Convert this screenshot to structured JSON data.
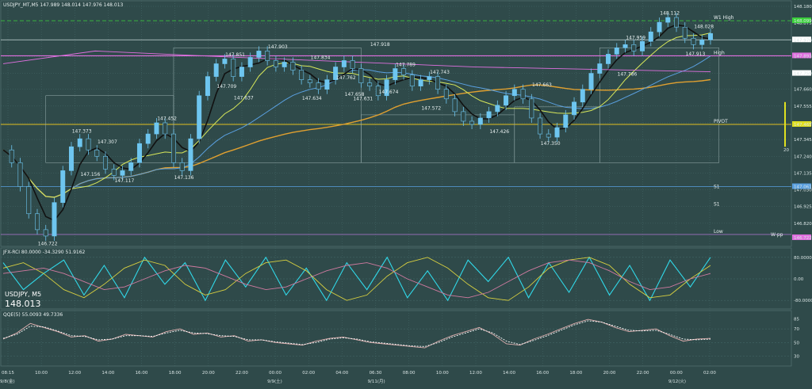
{
  "header": {
    "symbol_line": "USDJPY_MT,M5  147.989 148.014 147.976 148.013",
    "jfx_line": "JFX-RCI 80.0000 -34.3290 51.9162",
    "qqe_line": "QQE(5) 55.0093 49.7336",
    "big_symbol": "USDJPY, M5",
    "big_price": "148.013"
  },
  "colors": {
    "background": "#2f4a4a",
    "grid": "#466a6a",
    "candle": "#6ec6f0",
    "ma_fast": "#d8e85a",
    "ma_black": "#111111",
    "ma_blue": "#5aa0e0",
    "ma_orange": "#e0a030",
    "pink": "#e070e0",
    "green_dash": "#3cd43c",
    "rci_cyan": "#30d8e8",
    "rci_yellow": "#d8d040",
    "rci_pink": "#d07aa0",
    "qqe_line": "#e0b0b0"
  },
  "chart_data": [
    {
      "type": "line",
      "name": "price",
      "ylim": [
        146.7,
        148.18
      ],
      "y_ticks": [
        "148.180",
        "148.075",
        "147.970",
        "147.865",
        "147.760",
        "147.660",
        "147.555",
        "147.450",
        "147.345",
        "147.240",
        "147.135",
        "147.030",
        "146.925",
        "146.820"
      ],
      "x_ticks": [
        "08:15",
        "10:00",
        "12:00",
        "14:00",
        "16:00",
        "18:00",
        "20:00",
        "22:00",
        "00:00",
        "02:00",
        "04:00",
        "06:30",
        "08:00",
        "10:00",
        "12:00",
        "14:00",
        "16:00",
        "18:00",
        "20:00",
        "22:00",
        "00:00",
        "02:00"
      ],
      "date_labels": [
        {
          "text": "9/8(金)",
          "at_tick": 0
        },
        {
          "text": "9/9(土)",
          "at_tick": 8
        },
        {
          "text": "9/11(月)",
          "at_tick": 11
        },
        {
          "text": "9/12(火)",
          "at_tick": 20
        }
      ],
      "price_points": [
        [
          0,
          147.28
        ],
        [
          1,
          147.2
        ],
        [
          2,
          147.05
        ],
        [
          3,
          146.88
        ],
        [
          4,
          146.78
        ],
        [
          5,
          146.74
        ],
        [
          6,
          146.95
        ],
        [
          7,
          147.15
        ],
        [
          8,
          147.3
        ],
        [
          9,
          147.35
        ],
        [
          10,
          147.28
        ],
        [
          11,
          147.24
        ],
        [
          12,
          147.16
        ],
        [
          13,
          147.12
        ],
        [
          14,
          147.15
        ],
        [
          15,
          147.2
        ],
        [
          16,
          147.32
        ],
        [
          17,
          147.38
        ],
        [
          18,
          147.45
        ],
        [
          19,
          147.38
        ],
        [
          20,
          147.2
        ],
        [
          21,
          147.15
        ],
        [
          22,
          147.35
        ],
        [
          23,
          147.62
        ],
        [
          24,
          147.74
        ],
        [
          25,
          147.82
        ],
        [
          26,
          147.85
        ],
        [
          27,
          147.74
        ],
        [
          28,
          147.8
        ],
        [
          29,
          147.86
        ],
        [
          30,
          147.9
        ],
        [
          31,
          147.84
        ],
        [
          32,
          147.8
        ],
        [
          33,
          147.83
        ],
        [
          34,
          147.78
        ],
        [
          35,
          147.72
        ],
        [
          36,
          147.7
        ],
        [
          37,
          147.66
        ],
        [
          38,
          147.72
        ],
        [
          39,
          147.8
        ],
        [
          40,
          147.84
        ],
        [
          41,
          147.79
        ],
        [
          42,
          147.7
        ],
        [
          43,
          147.68
        ],
        [
          44,
          147.62
        ],
        [
          45,
          147.72
        ],
        [
          46,
          147.79
        ],
        [
          47,
          147.75
        ],
        [
          48,
          147.68
        ],
        [
          49,
          147.72
        ],
        [
          50,
          147.74
        ],
        [
          51,
          147.66
        ],
        [
          52,
          147.6
        ],
        [
          53,
          147.52
        ],
        [
          54,
          147.46
        ],
        [
          55,
          147.44
        ],
        [
          56,
          147.48
        ],
        [
          57,
          147.52
        ],
        [
          58,
          147.56
        ],
        [
          59,
          147.62
        ],
        [
          60,
          147.66
        ],
        [
          61,
          147.6
        ],
        [
          62,
          147.48
        ],
        [
          63,
          147.38
        ],
        [
          64,
          147.36
        ],
        [
          65,
          147.42
        ],
        [
          66,
          147.5
        ],
        [
          67,
          147.58
        ],
        [
          68,
          147.66
        ],
        [
          69,
          147.76
        ],
        [
          70,
          147.82
        ],
        [
          71,
          147.88
        ],
        [
          72,
          147.92
        ],
        [
          73,
          147.94
        ],
        [
          74,
          147.9
        ],
        [
          75,
          147.96
        ],
        [
          76,
          148.02
        ],
        [
          77,
          148.08
        ],
        [
          78,
          148.11
        ],
        [
          79,
          148.05
        ],
        [
          80,
          147.98
        ],
        [
          81,
          147.94
        ],
        [
          82,
          147.97
        ],
        [
          83,
          148.01
        ]
      ],
      "price_labels": [
        {
          "text": "146.722",
          "i": 5
        },
        {
          "text": "147.373",
          "i": 9
        },
        {
          "text": "147.307",
          "i": 12
        },
        {
          "text": "147.156",
          "i": 10
        },
        {
          "text": "147.117",
          "i": 14
        },
        {
          "text": "147.452",
          "i": 19
        },
        {
          "text": "147.136",
          "i": 21
        },
        {
          "text": "147.851",
          "i": 27
        },
        {
          "text": "147.709",
          "i": 26
        },
        {
          "text": "147.637",
          "i": 28
        },
        {
          "text": "147.903",
          "i": 32
        },
        {
          "text": "147.834",
          "i": 37
        },
        {
          "text": "147.634",
          "i": 36
        },
        {
          "text": "147.762",
          "i": 40
        },
        {
          "text": "147.658",
          "i": 41
        },
        {
          "text": "147.631",
          "i": 42
        },
        {
          "text": "147.918",
          "i": 44
        },
        {
          "text": "147.789",
          "i": 47
        },
        {
          "text": "147.743",
          "i": 51
        },
        {
          "text": "147.572",
          "i": 50
        },
        {
          "text": "147.674",
          "i": 45
        },
        {
          "text": "147.426",
          "i": 58
        },
        {
          "text": "147.663",
          "i": 63
        },
        {
          "text": "147.350",
          "i": 64
        },
        {
          "text": "147.959",
          "i": 74
        },
        {
          "text": "147.786",
          "i": 73
        },
        {
          "text": "148.112",
          "i": 78
        },
        {
          "text": "148.028",
          "i": 82
        },
        {
          "text": "147.913",
          "i": 81
        }
      ],
      "level_labels": [
        {
          "text": "W1 High",
          "price": 148.09
        },
        {
          "text": "High",
          "price": 147.87
        },
        {
          "text": "PIVOT",
          "price": 147.44
        },
        {
          "text": "S1",
          "price": 147.03
        },
        {
          "text": "S1",
          "price": 146.92
        },
        {
          "text": "Low",
          "price": 146.75
        },
        {
          "text": "W-pp",
          "price": 146.73
        }
      ],
      "price_box_labels": [
        {
          "text": "148.099",
          "price": 148.09,
          "color": "#3cd43c"
        },
        {
          "text": "147.976",
          "price": 147.97,
          "color": "#ffffff"
        },
        {
          "text": "147.893",
          "price": 147.87,
          "color": "#e070e0"
        },
        {
          "text": "147.759",
          "price": 147.76,
          "color": "#ffffff"
        },
        {
          "text": "147.465",
          "price": 147.44,
          "color": "#e0e020"
        },
        {
          "text": "147.061",
          "price": 147.05,
          "color": "#5aa0e0"
        },
        {
          "text": "146.722",
          "price": 146.73,
          "color": "#e070e0"
        }
      ],
      "side_value": "20"
    },
    {
      "type": "line",
      "name": "rci",
      "ylim": [
        -100,
        100
      ],
      "y_ticks": [
        "80.0000",
        "0.00",
        "-80.0000"
      ],
      "series": [
        {
          "values": [
            60,
            -40,
            20,
            70,
            -60,
            50,
            -70,
            80,
            -20,
            60,
            -80,
            70,
            -30,
            80,
            -60,
            40,
            -80,
            60,
            -40,
            80,
            -70,
            30,
            -80,
            70,
            -10,
            80,
            -70,
            60,
            -50,
            80,
            -60,
            50,
            -80,
            70,
            -30,
            80
          ]
        },
        {
          "values": [
            40,
            60,
            20,
            -40,
            -70,
            -20,
            40,
            70,
            50,
            -20,
            -60,
            -40,
            20,
            60,
            70,
            30,
            -40,
            -80,
            -60,
            10,
            60,
            80,
            40,
            -20,
            -70,
            -80,
            -30,
            40,
            70,
            80,
            50,
            -20,
            -70,
            -60,
            0,
            50
          ]
        },
        {
          "values": [
            20,
            30,
            40,
            20,
            -10,
            -40,
            -30,
            0,
            30,
            50,
            40,
            10,
            -20,
            -40,
            -30,
            0,
            30,
            50,
            60,
            40,
            0,
            -30,
            -60,
            -70,
            -50,
            -10,
            30,
            60,
            70,
            60,
            30,
            -10,
            -40,
            -30,
            0,
            20
          ]
        }
      ]
    },
    {
      "type": "line",
      "name": "qqe",
      "ylim": [
        20,
        90
      ],
      "y_ticks": [
        "85",
        "70",
        "50",
        "30"
      ],
      "series": [
        {
          "values": [
            55,
            64,
            78,
            72,
            66,
            58,
            60,
            52,
            55,
            62,
            60,
            58,
            66,
            70,
            62,
            64,
            58,
            60,
            52,
            54,
            50,
            48,
            46,
            52,
            56,
            58,
            54,
            50,
            48,
            46,
            44,
            42,
            52,
            60,
            66,
            72,
            62,
            48,
            46,
            55,
            62,
            70,
            78,
            84,
            80,
            72,
            66,
            68,
            70,
            60,
            52,
            55,
            56
          ]
        },
        {
          "values": [
            56,
            62,
            74,
            73,
            67,
            60,
            59,
            54,
            55,
            60,
            60,
            59,
            64,
            68,
            64,
            63,
            60,
            59,
            54,
            54,
            51,
            49,
            47,
            50,
            55,
            57,
            55,
            51,
            49,
            47,
            45,
            44,
            50,
            58,
            64,
            70,
            64,
            52,
            47,
            53,
            60,
            68,
            76,
            82,
            80,
            74,
            68,
            67,
            68,
            62,
            55,
            54,
            55
          ]
        }
      ]
    }
  ]
}
